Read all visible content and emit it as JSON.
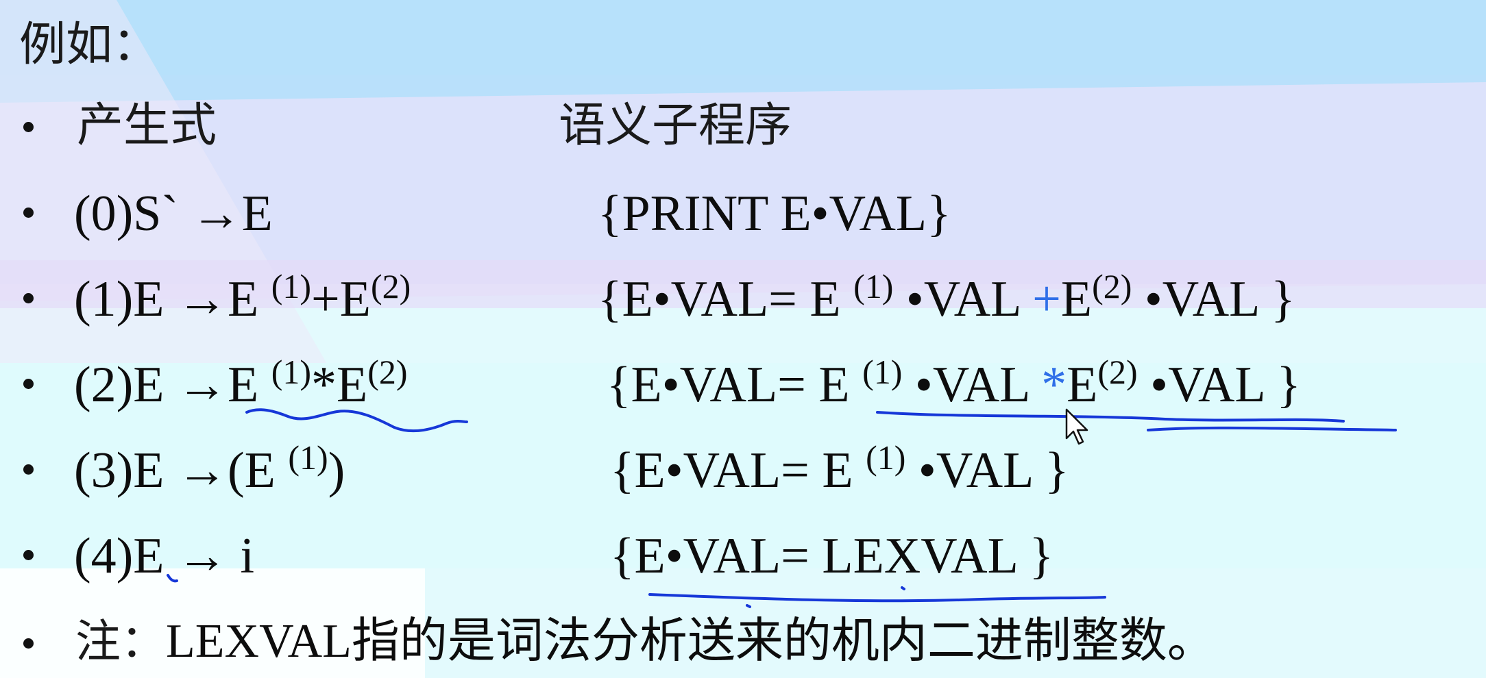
{
  "colors": {
    "sky_blue": "#b9e0fb",
    "lavender": "#e8e3fb",
    "pale_cyan": "#e3fafd",
    "white": "#ffffff",
    "ink": "#0d0d0d",
    "pen_blue": "#1637d8",
    "operator_blue": "#2f6fe8"
  },
  "intro": "例如：",
  "header": {
    "production": "产生式",
    "semantic": "语义子程序"
  },
  "rows": [
    {
      "num": "(0)",
      "lhs": "S` →E",
      "action": "{PRINT  E•VAL}"
    },
    {
      "num": "(1)",
      "lhs": "E →E",
      "sup1": "(1)",
      "op": "+",
      "rhs": "E",
      "sup2": "(2)",
      "a_pre": "{E•VAL= E ",
      "a_sup1": "(1)",
      "a_mid": "•VAL ",
      "a_op": "+",
      "a_e": "E",
      "a_sup2": "(2)",
      "a_post": "•VAL }"
    },
    {
      "num": "(2)",
      "lhs": "E →E",
      "sup1": "(1)",
      "op": "*",
      "rhs": "E",
      "sup2": "(2)",
      "a_pre": "{E•VAL= E ",
      "a_sup1": "(1)",
      "a_mid": "•VAL ",
      "a_op": "*",
      "a_e": "E",
      "a_sup2": "(2)",
      "a_post": "•VAL }"
    },
    {
      "num": "(3)",
      "lhs": "E →(E ",
      "sup1": "(1)",
      "close": ")",
      "a_pre": "{E•VAL= E ",
      "a_sup1": "(1)",
      "a_mid": "•VAL  }"
    },
    {
      "num": "(4)",
      "lhs": "E → i",
      "action": "{E•VAL= LEXVAL }"
    }
  ],
  "note": {
    "label": "注：",
    "text": "LEXVAL指的是词法分析送来的机内二进制整数。"
  }
}
